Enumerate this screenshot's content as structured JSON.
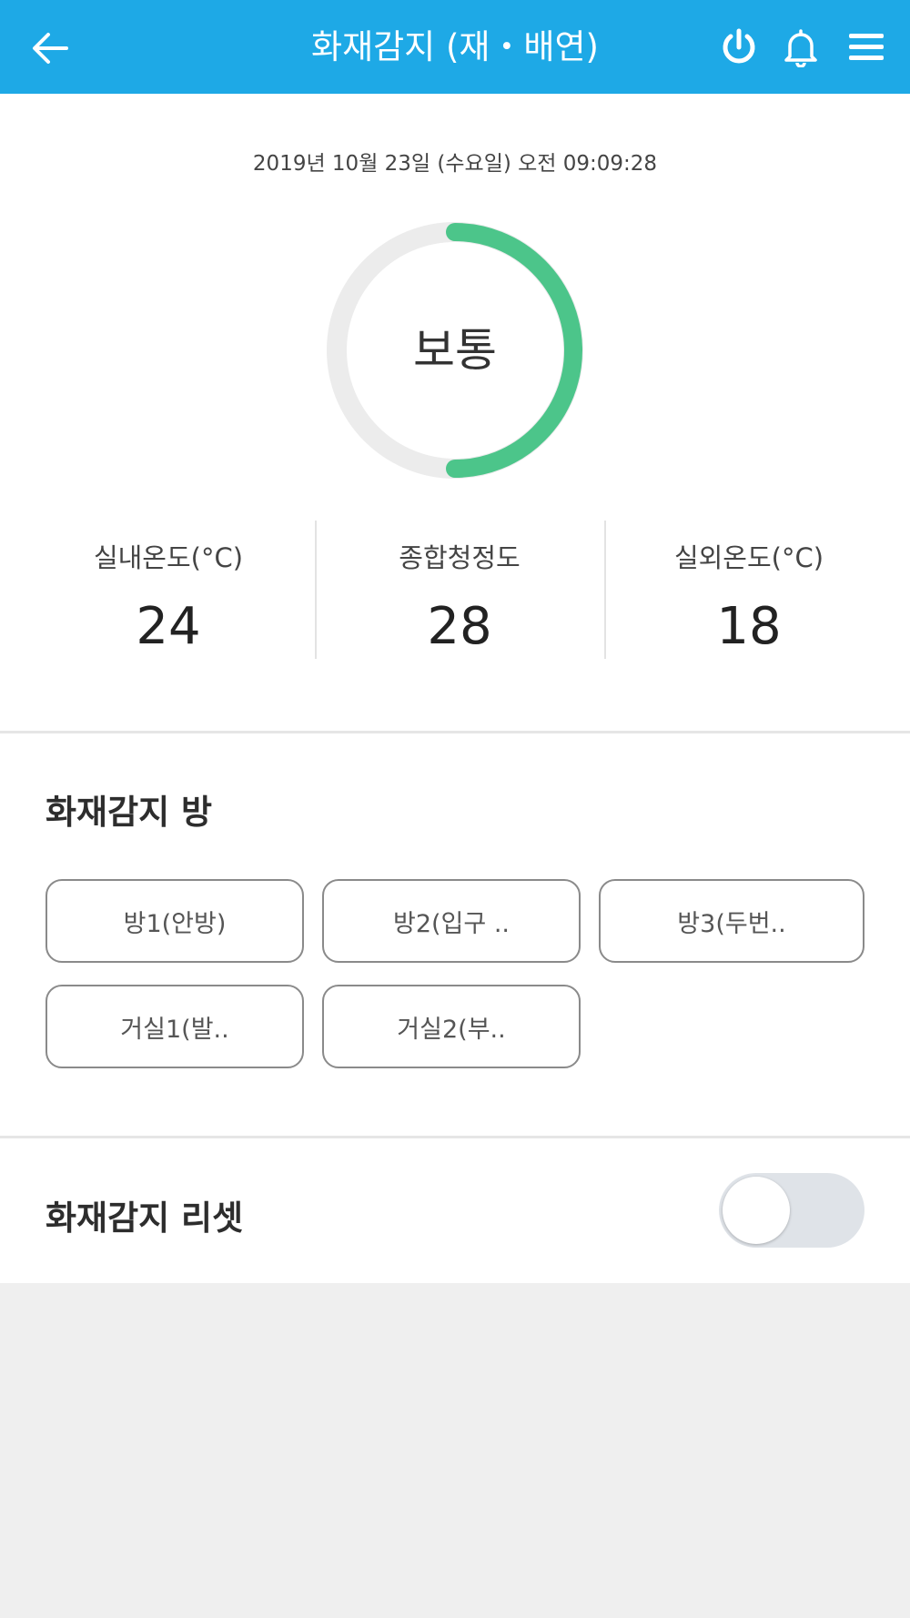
{
  "header": {
    "title": "화재감지 (재・배연)",
    "back_icon": "arrow-left-icon",
    "power_icon": "power-icon",
    "bell_icon": "bell-icon",
    "menu_icon": "hamburger-menu-icon",
    "bg_color": "#1ea9e6"
  },
  "status": {
    "datetime": "2019년 10월 23일 (수요일) 오전 09:09:28",
    "level_label": "보통",
    "gauge_fraction": 0.5,
    "gauge_color": "#4cc58a"
  },
  "stats": [
    {
      "label": "실내온도(°C)",
      "value": "24"
    },
    {
      "label": "종합청정도",
      "value": "28"
    },
    {
      "label": "실외온도(°C)",
      "value": "18"
    }
  ],
  "rooms": {
    "title": "화재감지 방",
    "items": [
      "방1(안방)",
      "방2(입구 ..",
      "방3(두번..",
      "거실1(발..",
      "거실2(부.."
    ]
  },
  "reset": {
    "title": "화재감지 리셋",
    "enabled": false
  }
}
